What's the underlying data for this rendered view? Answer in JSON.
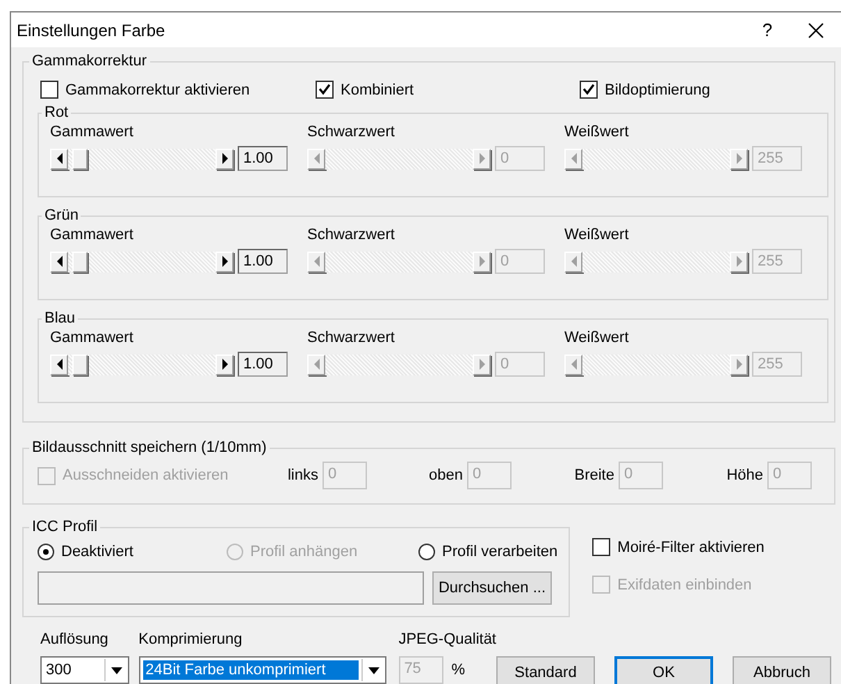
{
  "window": {
    "title": "Einstellungen Farbe",
    "help": "?"
  },
  "gamma": {
    "title": "Gammakorrektur",
    "options": [
      {
        "label": "Gammakorrektur aktivieren",
        "checked": false
      },
      {
        "label": "Kombiniert",
        "checked": true
      },
      {
        "label": "Bildoptimierung",
        "checked": true
      }
    ],
    "channels": [
      {
        "title": "Rot",
        "sliders": [
          {
            "label": "Gammawert",
            "value": "1.00",
            "disabled": false,
            "level": 0.03
          },
          {
            "label": "Schwarzwert",
            "value": "0",
            "disabled": true
          },
          {
            "label": "Weißwert",
            "value": "255",
            "disabled": true
          }
        ]
      },
      {
        "title": "Grün",
        "sliders": [
          {
            "label": "Gammawert",
            "value": "1.00",
            "disabled": false,
            "level": 0.03
          },
          {
            "label": "Schwarzwert",
            "value": "0",
            "disabled": true
          },
          {
            "label": "Weißwert",
            "value": "255",
            "disabled": true
          }
        ]
      },
      {
        "title": "Blau",
        "sliders": [
          {
            "label": "Gammawert",
            "value": "1.00",
            "disabled": false,
            "level": 0.03
          },
          {
            "label": "Schwarzwert",
            "value": "0",
            "disabled": true
          },
          {
            "label": "Weißwert",
            "value": "255",
            "disabled": true
          }
        ]
      }
    ]
  },
  "crop": {
    "title": "Bildausschnitt speichern (1/10mm)",
    "enable": {
      "label": "Ausschneiden aktivieren",
      "checked": false,
      "disabled": true
    },
    "fields": [
      {
        "label": "links",
        "value": "0"
      },
      {
        "label": "oben",
        "value": "0"
      },
      {
        "label": "Breite",
        "value": "0"
      },
      {
        "label": "Höhe",
        "value": "0"
      }
    ]
  },
  "icc": {
    "title": "ICC Profil",
    "radios": [
      {
        "label": "Deaktiviert",
        "selected": true,
        "disabled": false
      },
      {
        "label": "Profil anhängen",
        "selected": false,
        "disabled": true
      },
      {
        "label": "Profil verarbeiten",
        "selected": false,
        "disabled": false
      }
    ],
    "browse": "Durchsuchen ..."
  },
  "side_options": [
    {
      "label": "Moiré-Filter aktivieren",
      "checked": false,
      "disabled": false
    },
    {
      "label": "Exifdaten einbinden",
      "checked": false,
      "disabled": true
    }
  ],
  "resolution": {
    "label": "Auflösung",
    "value": "300"
  },
  "compression": {
    "label": "Komprimierung",
    "value": "24Bit Farbe unkomprimiert"
  },
  "jpeg": {
    "label": "JPEG-Qualität",
    "value": "75",
    "unit": "%",
    "disabled": true
  },
  "buttons": [
    "Standard",
    "OK",
    "Abbruch"
  ]
}
